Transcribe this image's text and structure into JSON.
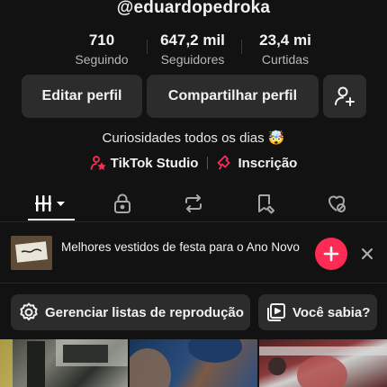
{
  "profile": {
    "username": "@eduardopedroka",
    "stats": [
      {
        "value": "710",
        "label": "Seguindo"
      },
      {
        "value": "647,2 mil",
        "label": "Seguidores"
      },
      {
        "value": "23,4 mi",
        "label": "Curtidas"
      }
    ],
    "buttons": {
      "edit": "Editar perfil",
      "share": "Compartilhar perfil",
      "add_friend_icon": "add-person-icon"
    },
    "bio": "Curiosidades todos os dias 🤯",
    "links": [
      {
        "label": "TikTok Studio",
        "icon": "studio-icon"
      },
      {
        "label": "Inscrição",
        "icon": "subscription-icon"
      }
    ]
  },
  "tabs": [
    {
      "name": "videos",
      "icon": "grid-icon",
      "active": true
    },
    {
      "name": "private",
      "icon": "lock-icon"
    },
    {
      "name": "reposts",
      "icon": "repost-icon"
    },
    {
      "name": "favorites",
      "icon": "bookmark-icon"
    },
    {
      "name": "liked",
      "icon": "heart-icon"
    }
  ],
  "playlist_suggestion": {
    "title": "Melhores vestidos de festa para o Ano Novo"
  },
  "actions": {
    "manage_playlists": "Gerenciar listas de reprodução",
    "did_you_know": "Você sabia?"
  },
  "colors": {
    "background": "#121212",
    "button_bg": "#2c2c2c",
    "accent": "#fe2c55"
  }
}
